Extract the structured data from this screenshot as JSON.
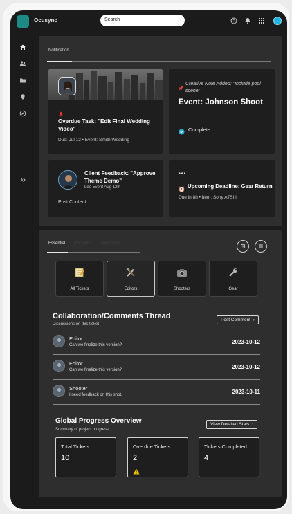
{
  "app": {
    "title": "Ocusync"
  },
  "search": {
    "placeholder": "Search"
  },
  "notifications": {
    "tab_label": "Notification",
    "cards": [
      {
        "title": "Overdue Task: \"Edit Final Wedding Video\"",
        "meta": "Due: Jul 12 • Event: Smith Wedding"
      },
      {
        "note": "Creative Note Added: \"Include pool scene\"",
        "title": "Event: Johnson Shoot",
        "status": "Complete"
      },
      {
        "title": "Client Feedback: \"Approve Theme Demo\"",
        "meta": "Lee Event Aug 12th",
        "action": "Post Content"
      },
      {
        "more": "•••",
        "title": "Upcoming Deadline: Gear Return",
        "meta": "Due in 8h • Item: Sony A7SIII"
      }
    ]
  },
  "tabs": [
    "Essential",
    "Contacts",
    "Saved Ads"
  ],
  "categories": [
    {
      "label": "All Tickets",
      "icon": "notepad-icon"
    },
    {
      "label": "Editors",
      "icon": "tools-icon"
    },
    {
      "label": "Shooters",
      "icon": "camera-icon"
    },
    {
      "label": "Gear",
      "icon": "wrench-icon"
    }
  ],
  "collab": {
    "title": "Collaboration/Comments Thread",
    "subtitle": "Discussions on this ticket",
    "button": "Post Comment",
    "comments": [
      {
        "name": "Editor",
        "text": "Can we finalize this version?",
        "date": "2023-10-12"
      },
      {
        "name": "Editor",
        "text": "Can we finalize this version?",
        "date": "2023-10-12"
      },
      {
        "name": "Shooter",
        "text": "I need feedback on this shot.",
        "date": "2023-10-11"
      }
    ]
  },
  "progress": {
    "title": "Global Progress Overview",
    "subtitle": "Summary of project progress",
    "button": "View Detailed Stats",
    "stats": [
      {
        "label": "Total Tickets",
        "value": "10"
      },
      {
        "label": "Overdue Tickets",
        "value": "2"
      },
      {
        "label": "Tickets Completed",
        "value": "4"
      }
    ]
  },
  "colors": {
    "accent": "#1e8a86",
    "avatar": "#1fb5e0",
    "warning": "#f2c200",
    "complete": "#2aa6c9",
    "alert": "#e03030"
  }
}
